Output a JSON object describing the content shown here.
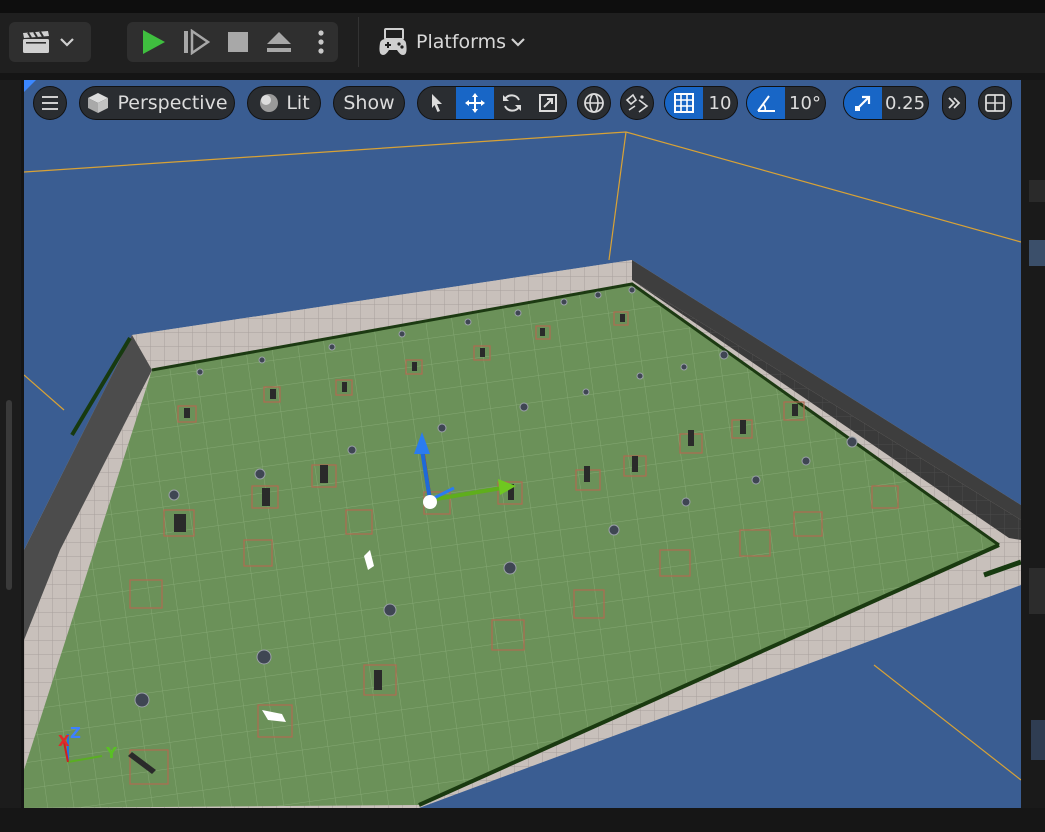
{
  "toolbar": {
    "platforms_label": "Platforms"
  },
  "viewport": {
    "view_mode": "Perspective",
    "lighting_mode": "Lit",
    "show_label": "Show",
    "grid_snap_value": "10",
    "rotation_snap_value": "10°",
    "scale_snap_value": "0.25"
  },
  "gizmo_axes": [
    "X",
    "Y",
    "Z"
  ],
  "colors": {
    "viewport_bg": "#3a5d92",
    "floor": "#6a8f58",
    "accent_blue": "#1866c6",
    "play_green": "#3fbf3f"
  },
  "icons": [
    "clapperboard-icon",
    "chevron-down-icon",
    "play-icon",
    "skip-frame-icon",
    "stop-icon",
    "eject-icon",
    "more-vertical-icon",
    "gamepad-icon",
    "hamburger-menu-icon",
    "cube-icon",
    "lit-sphere-icon",
    "select-arrow-icon",
    "move-icon",
    "rotate-icon",
    "scale-icon",
    "globe-icon",
    "surface-snap-icon",
    "grid-icon",
    "angle-icon",
    "scale-snap-icon",
    "double-chevron-right-icon",
    "layout-grid-icon"
  ]
}
